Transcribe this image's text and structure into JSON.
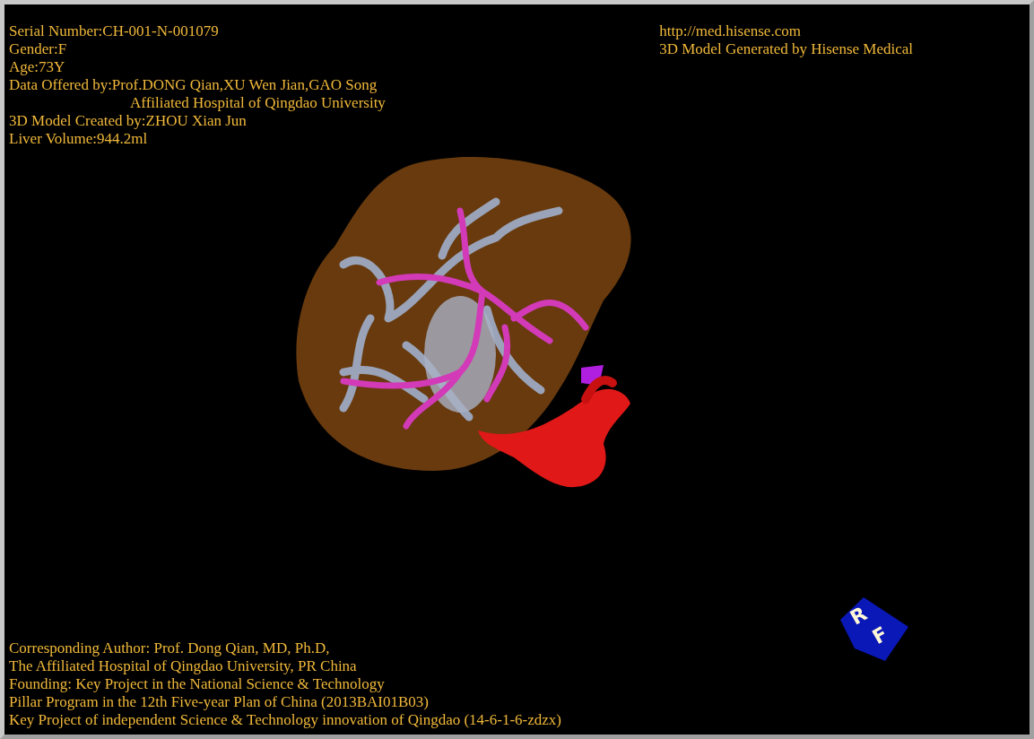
{
  "info_left": [
    "Serial Number:CH-001-N-001079",
    "Gender:F",
    "Age:73Y",
    "Data Offered by:Prof.DONG Qian,XU Wen Jian,GAO Song",
    "Affiliated Hospital of Qingdao University",
    "3D Model Created by:ZHOU Xian Jun",
    "Liver Volume:944.2ml"
  ],
  "info_right": [
    "http://med.hisense.com",
    "3D Model Generated by Hisense Medical"
  ],
  "credits": [
    "Corresponding Author: Prof. Dong Qian, MD, Ph.D,",
    "The Affiliated Hospital of Qingdao University, PR China",
    "Founding: Key Project in the National Science & Technology",
    "Pillar Program in the 12th Five-year Plan of China (2013BAI01B03)",
    "Key Project of independent Science & Technology innovation of Qingdao (14-6-1-6-zdzx)"
  ],
  "orientation_cube": {
    "labels": [
      "R",
      "F"
    ]
  }
}
